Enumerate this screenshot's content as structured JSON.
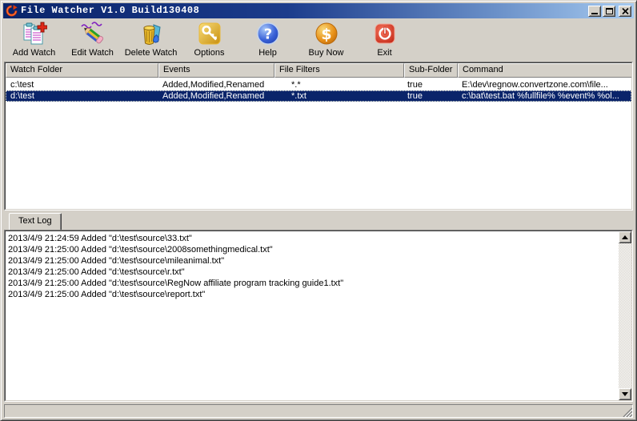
{
  "window": {
    "title": "File Watcher V1.0 Build130408"
  },
  "toolbar": {
    "buttons": [
      {
        "label": "Add Watch",
        "icon": "add-watch-icon"
      },
      {
        "label": "Edit Watch",
        "icon": "edit-watch-icon"
      },
      {
        "label": "Delete Watch",
        "icon": "delete-watch-icon"
      },
      {
        "label": "Options",
        "icon": "options-key-icon"
      },
      {
        "label": "Help",
        "icon": "help-question-icon"
      },
      {
        "label": "Buy Now",
        "icon": "buy-now-dollar-icon"
      },
      {
        "label": "Exit",
        "icon": "exit-power-icon"
      }
    ]
  },
  "watch_list": {
    "columns": [
      "Watch Folder",
      "Events",
      "File Filters",
      "Sub-Folder",
      "Command"
    ],
    "rows": [
      {
        "watch_folder": "c:\\test",
        "events": "Added,Modified,Renamed",
        "file_filters": "*.*",
        "sub_folder": "true",
        "command": "E:\\dev\\regnow.convertzone.com\\file...",
        "selected": false
      },
      {
        "watch_folder": "d:\\test",
        "events": "Added,Modified,Renamed",
        "file_filters": "*.txt",
        "sub_folder": "true",
        "command": "c:\\bat\\test.bat %fullfile% %event% %ol...",
        "selected": true
      }
    ]
  },
  "log_panel": {
    "tab_label": "Text Log",
    "lines": [
      "2013/4/9 21:24:59 Added \"d:\\test\\source\\33.txt\"",
      "2013/4/9 21:25:00 Added \"d:\\test\\source\\2008somethingmedical.txt\"",
      "2013/4/9 21:25:00 Added \"d:\\test\\source\\mileanimal.txt\"",
      "2013/4/9 21:25:00 Added \"d:\\test\\source\\r.txt\"",
      "2013/4/9 21:25:00 Added \"d:\\test\\source\\RegNow affiliate program tracking guide1.txt\"",
      "2013/4/9 21:25:00 Added \"d:\\test\\source\\report.txt\""
    ]
  },
  "colors": {
    "title_gradient_start": "#0a246a",
    "title_gradient_end": "#a6caf0",
    "chrome": "#d4d0c8",
    "selection_bg": "#0a246a",
    "selection_text": "#ffffff"
  }
}
